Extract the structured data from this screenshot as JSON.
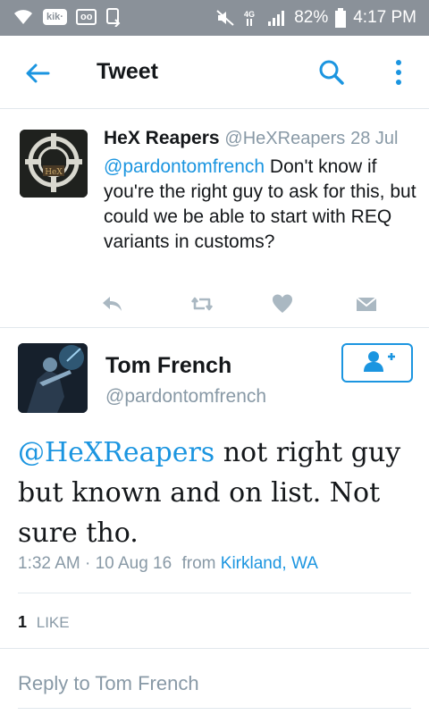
{
  "status_bar": {
    "kik_label": "kik·",
    "voicemail_label": "oo",
    "network_label": "4G",
    "battery": "82%",
    "time": "4:17 PM"
  },
  "toolbar": {
    "title": "Tweet",
    "back_icon": "arrow-left",
    "search_icon": "search",
    "more_icon": "more-vertical"
  },
  "parent_tweet": {
    "name": "HeX Reapers",
    "handle": "@HeXReapers",
    "date": "28 Jul",
    "mention": "@pardontomfrench",
    "text": " Don't know if you're the right guy to ask for this, but could we be able to start with REQ variants in customs?",
    "avatar_label": "HeX"
  },
  "main_tweet": {
    "name": "Tom French",
    "handle": "@pardontomfrench",
    "mention": "@HeXReapers",
    "text": " not right guy but known and on list. Not sure tho.",
    "time": "1:32 AM",
    "date": "10 Aug 16",
    "from_label": "from",
    "location": "Kirkland, WA",
    "like_count": "1",
    "like_label": "LIKE"
  },
  "reply_placeholder": "Reply to Tom French",
  "colors": {
    "accent": "#1b95e0",
    "secondary_text": "#8899a6",
    "status_bar": "#8a9199",
    "divider": "#e1e8ed"
  }
}
